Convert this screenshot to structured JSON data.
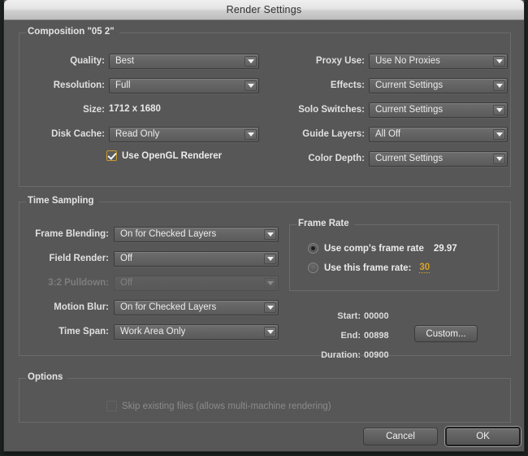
{
  "window": {
    "title": "Render Settings"
  },
  "composition": {
    "legend": "Composition \"05 2\"",
    "left_fields": [
      {
        "label": "Quality:",
        "value": "Best",
        "type": "dropdown",
        "disabled": false
      },
      {
        "label": "Resolution:",
        "value": "Full",
        "type": "dropdown",
        "disabled": false
      },
      {
        "label": "Size:",
        "value": "1712 x 1680",
        "type": "static",
        "disabled": false
      },
      {
        "label": "Disk Cache:",
        "value": "Read Only",
        "type": "dropdown",
        "disabled": false
      }
    ],
    "opengl_checkbox": {
      "label": "Use OpenGL Renderer",
      "checked": true
    },
    "right_fields": [
      {
        "label": "Proxy Use:",
        "value": "Use No Proxies",
        "type": "dropdown",
        "disabled": false
      },
      {
        "label": "Effects:",
        "value": "Current Settings",
        "type": "dropdown",
        "disabled": false
      },
      {
        "label": "Solo Switches:",
        "value": "Current Settings",
        "type": "dropdown",
        "disabled": false
      },
      {
        "label": "Guide Layers:",
        "value": "All Off",
        "type": "dropdown",
        "disabled": false
      },
      {
        "label": "Color Depth:",
        "value": "Current Settings",
        "type": "dropdown",
        "disabled": false
      }
    ]
  },
  "time_sampling": {
    "legend": "Time Sampling",
    "fields": [
      {
        "label": "Frame Blending:",
        "value": "On for Checked Layers",
        "disabled": false
      },
      {
        "label": "Field Render:",
        "value": "Off",
        "disabled": false
      },
      {
        "label": "3:2 Pulldown:",
        "value": "Off",
        "disabled": true
      },
      {
        "label": "Motion Blur:",
        "value": "On for Checked Layers",
        "disabled": false
      },
      {
        "label": "Time Span:",
        "value": "Work Area Only",
        "disabled": false
      }
    ],
    "frame_rate": {
      "legend": "Frame Rate",
      "option_comp": {
        "label": "Use comp's frame rate",
        "value": "29.97",
        "selected": true
      },
      "option_custom": {
        "label": "Use this frame rate:",
        "value": "30",
        "selected": false
      }
    },
    "time_info": {
      "start_label": "Start:",
      "start_value": "00000",
      "end_label": "End:",
      "end_value": "00898",
      "duration_label": "Duration:",
      "duration_value": "00900",
      "custom_button": "Custom..."
    }
  },
  "options": {
    "legend": "Options",
    "skip_checkbox": {
      "label": "Skip existing files (allows multi-machine rendering)",
      "checked": false,
      "disabled": true
    }
  },
  "footer": {
    "cancel": "Cancel",
    "ok": "OK"
  },
  "colors": {
    "dialog_bg": "#575757",
    "accent_orange": "#d8a22a",
    "titlebar_text": "#2f2f2f"
  }
}
